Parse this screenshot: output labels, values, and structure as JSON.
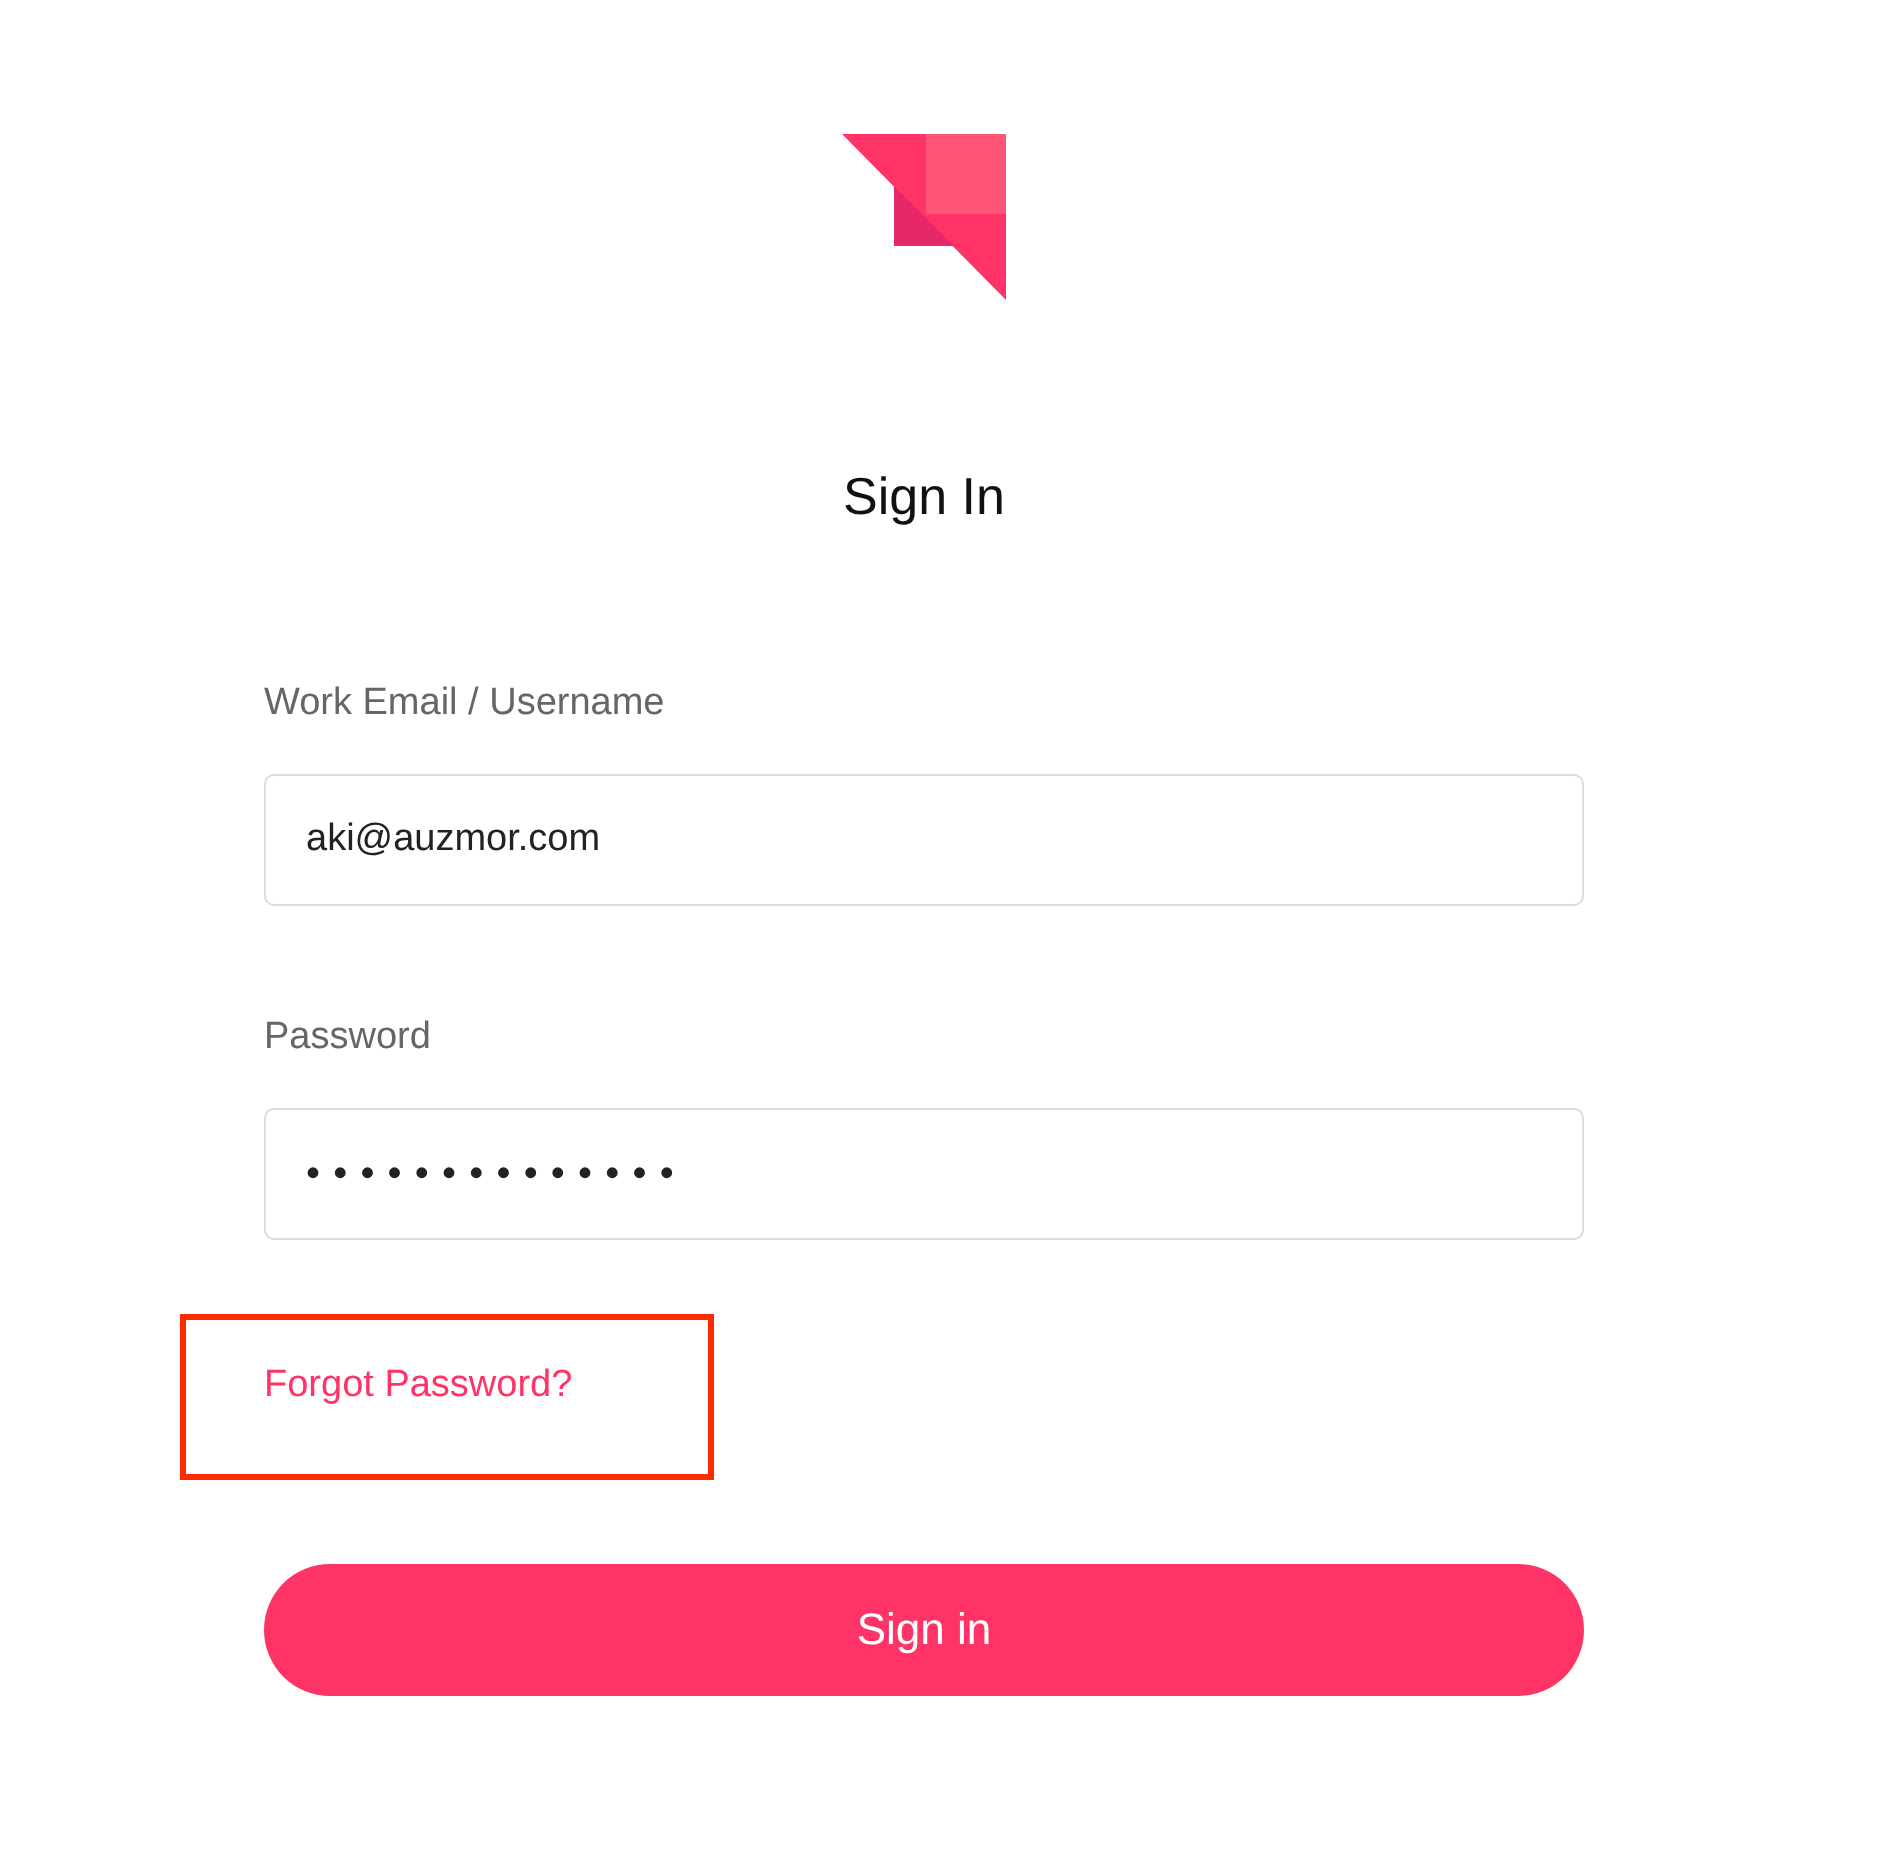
{
  "title": "Sign In",
  "fields": [
    {
      "kind": "text",
      "label": "Work Email / Username",
      "value": "aki@auzmor.com"
    },
    {
      "kind": "password",
      "label": "Password",
      "value": "••••••••••••••"
    }
  ],
  "forgot_password": {
    "label": "Forgot Password?",
    "highlighted": true
  },
  "submit_button": {
    "label": "Sign in"
  }
}
